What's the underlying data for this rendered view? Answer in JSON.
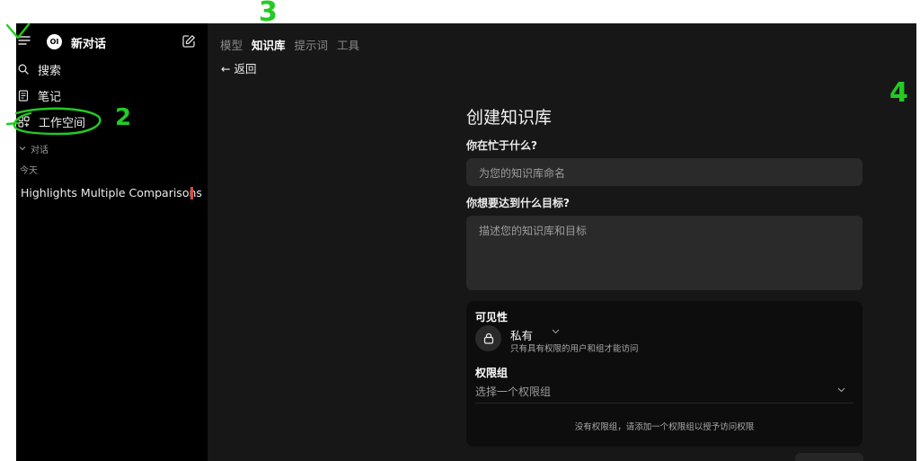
{
  "sidebar": {
    "logo_text": "OI",
    "new_chat_label": "新对话",
    "items": [
      {
        "label": "搜索",
        "icon": "search-icon"
      },
      {
        "label": "笔记",
        "icon": "notes-icon"
      },
      {
        "label": "工作空间",
        "icon": "workspace-icon"
      }
    ],
    "section_label": "对话",
    "date_group": "今天",
    "chats": [
      {
        "title": "Highlights Multiple Comparisons"
      }
    ]
  },
  "header": {
    "tabs": [
      {
        "label": "模型",
        "active": false
      },
      {
        "label": "知识库",
        "active": true
      },
      {
        "label": "提示词",
        "active": false
      },
      {
        "label": "工具",
        "active": false
      }
    ],
    "back_label": "← 返回"
  },
  "form": {
    "title": "创建知识库",
    "name_question": "你在忙于什么?",
    "name_placeholder": "为您的知识库命名",
    "goal_question": "你想要达到什么目标?",
    "goal_placeholder": "描述您的知识库和目标",
    "visibility": {
      "label": "可见性",
      "value": "私有",
      "description": "只有具有权限的用户和组才能访问"
    },
    "groups": {
      "label": "权限组",
      "select_placeholder": "选择一个权限组",
      "empty_message": "没有权限组，请添加一个权限组以授予访问权限"
    }
  },
  "annotations": {
    "color": "#22cc22",
    "marks": [
      "2",
      "3",
      "4"
    ]
  }
}
